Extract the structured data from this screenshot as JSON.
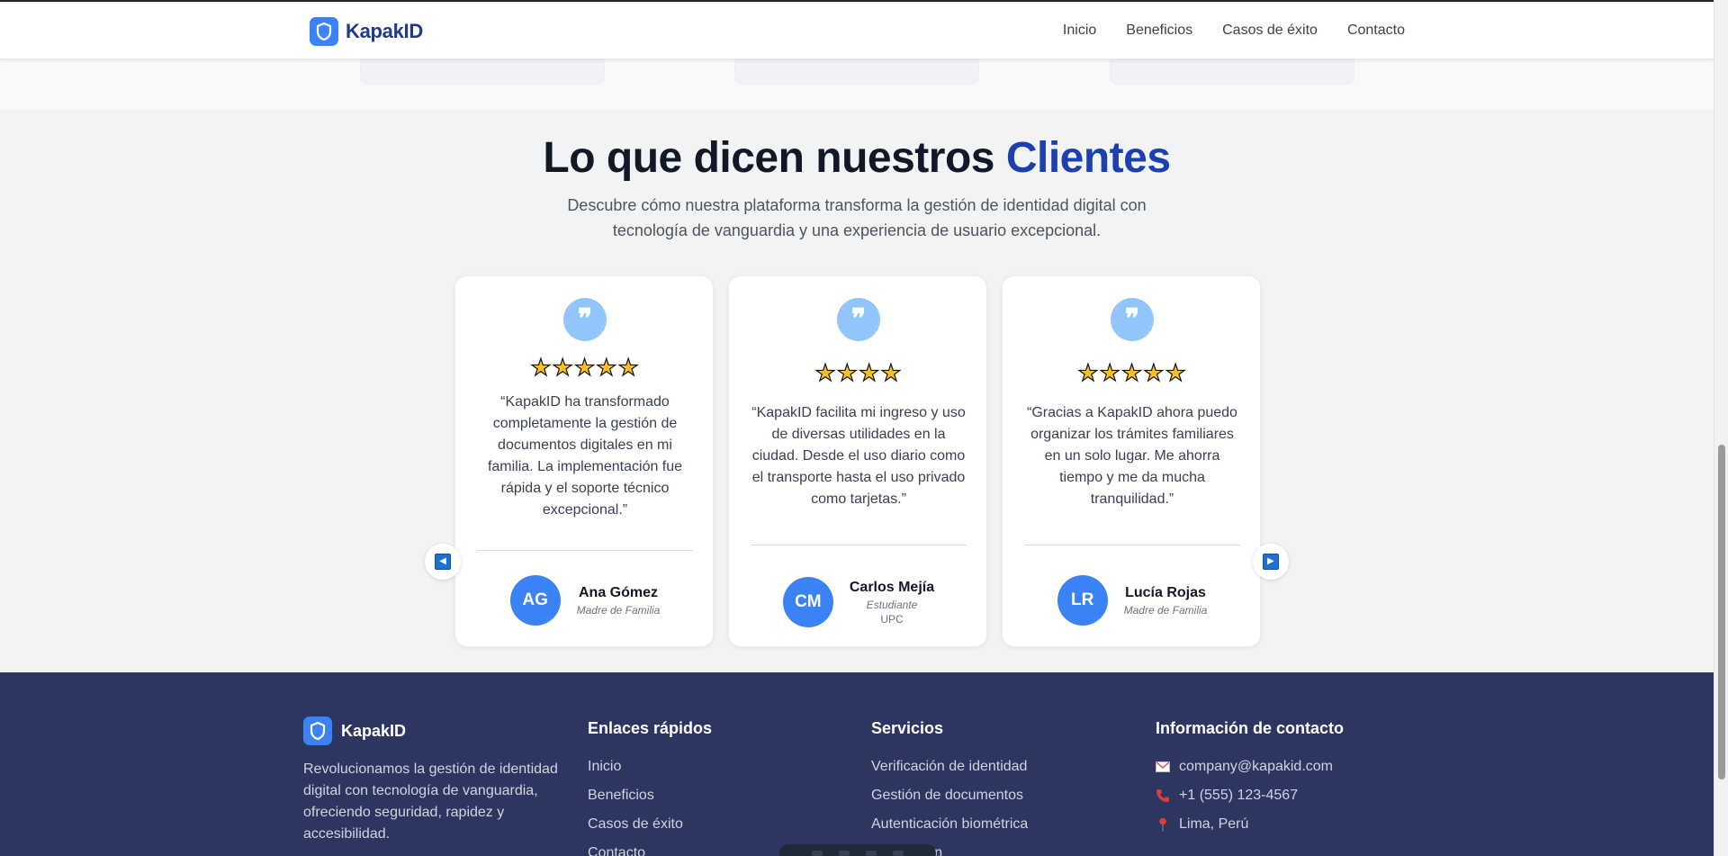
{
  "header": {
    "brand": "KapakID",
    "nav": [
      "Inicio",
      "Beneficios",
      "Casos de éxito",
      "Contacto"
    ]
  },
  "testimonials": {
    "title_main": "Lo que dicen nuestros ",
    "title_accent": "Clientes",
    "subtitle": "Descubre cómo nuestra plataforma transforma la gestión de identidad digital con tecnología de vanguardia y una experiencia de usuario excepcional.",
    "quote_glyph": "❞",
    "cards": [
      {
        "stars": "★★★★★",
        "rating": 5,
        "quote": "“KapakID ha transformado completamente la gestión de documentos digitales en mi familia. La implementación fue rápida y el soporte técnico excepcional.”",
        "initials": "AG",
        "name": "Ana Gómez",
        "role": "Madre de Familia",
        "org": ""
      },
      {
        "stars": "★★★★",
        "rating": 4,
        "quote": "“KapakID facilita mi ingreso y uso de diversas utilidades en la ciudad. Desde el uso diario como el transporte hasta el uso privado como tarjetas.”",
        "initials": "CM",
        "name": "Carlos Mejía",
        "role": "Estudiante",
        "org": "UPC"
      },
      {
        "stars": "★★★★★",
        "rating": 5,
        "quote": "“Gracias a KapakID ahora puedo organizar los trámites familiares en un solo lugar. Me ahorra tiempo y me da mucha tranquilidad.”",
        "initials": "LR",
        "name": "Lucía Rojas",
        "role": "Madre de Familia",
        "org": ""
      }
    ],
    "prev_arrow": "◀",
    "next_arrow": "▶"
  },
  "footer": {
    "brand": "KapakID",
    "description": "Revolucionamos la gestión de identidad digital con tecnología de vanguardia, ofreciendo seguridad, rapidez y accesibilidad.",
    "quick_links": {
      "title": "Enlaces rápidos",
      "items": [
        "Inicio",
        "Beneficios",
        "Casos de éxito",
        "Contacto"
      ]
    },
    "services": {
      "title": "Servicios",
      "items": [
        "Verificación de identidad",
        "Gestión de documentos",
        "Autenticación biométrica",
        "Integración"
      ]
    },
    "contact": {
      "title": "Información de contacto",
      "email": "company@kapakid.com",
      "phone": "+1 (555) 123-4567",
      "location": "Lima, Perú"
    }
  },
  "colors": {
    "brand_blue": "#3b82f6",
    "accent_dark_blue": "#1e40af",
    "footer_bg": "#2d3561",
    "star": "#fbbf24"
  }
}
